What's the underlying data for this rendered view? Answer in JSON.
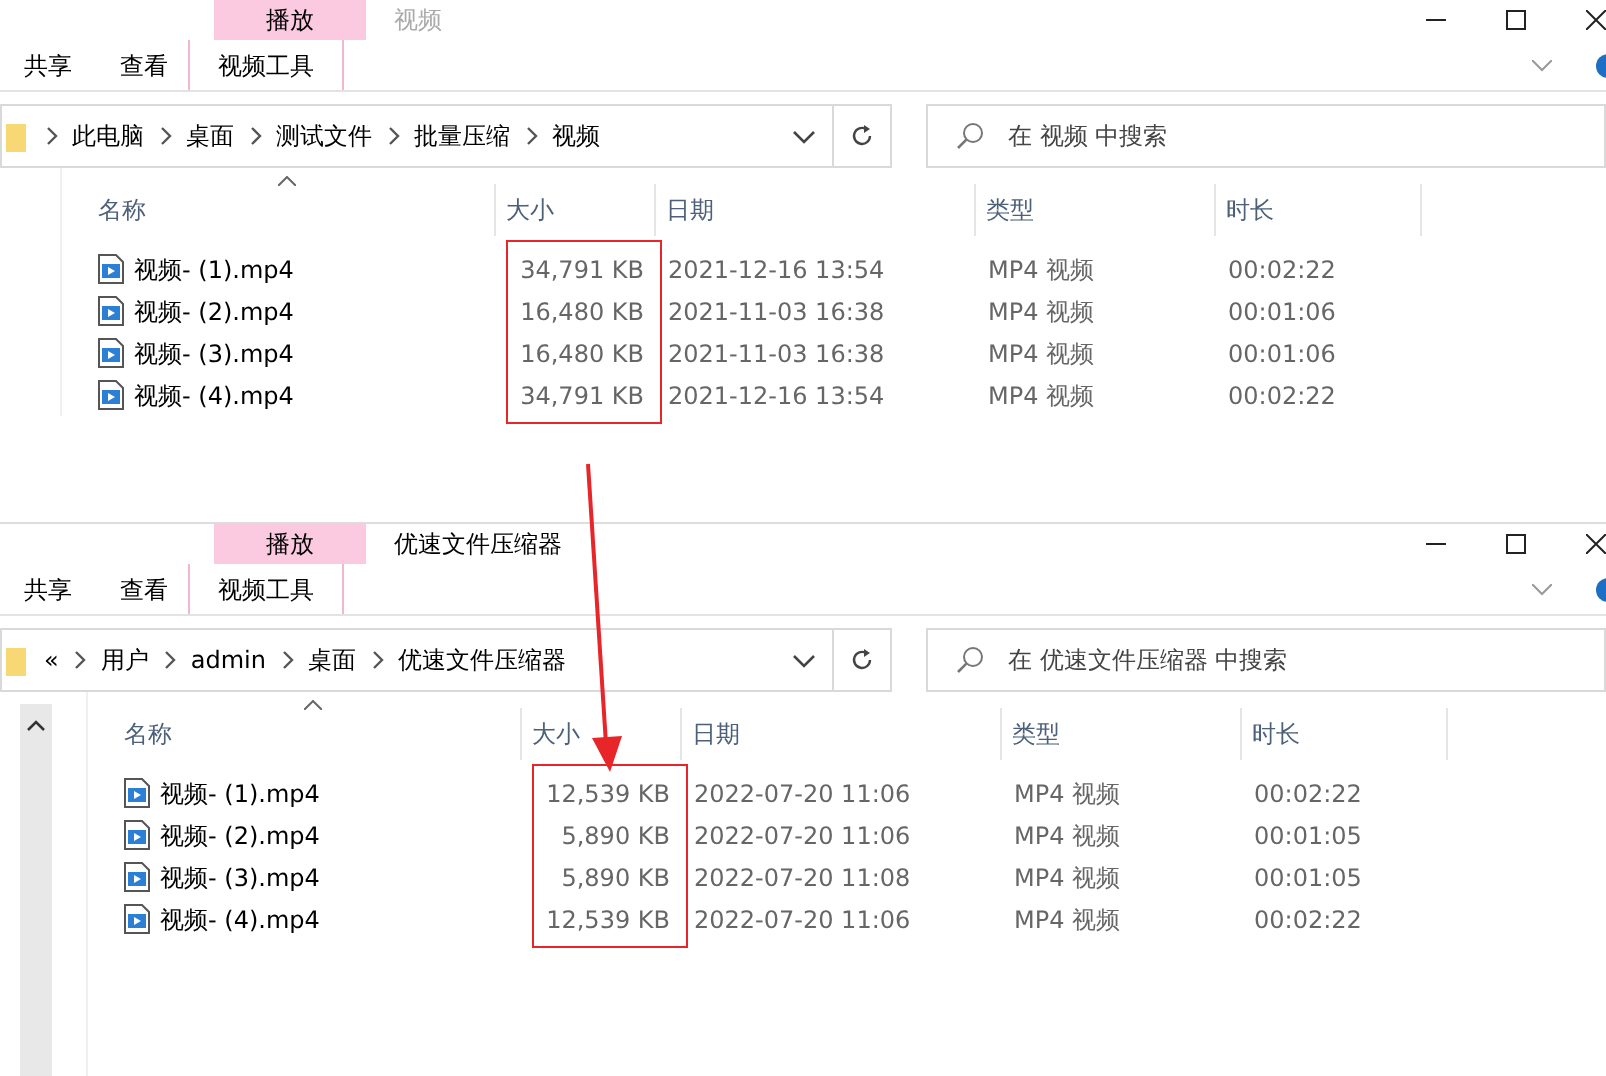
{
  "windows": [
    {
      "title": "视频",
      "active": false,
      "context_tab": "播放",
      "ribbon_tabs": [
        {
          "label": "共享",
          "selected": false
        },
        {
          "label": "查看",
          "selected": false
        },
        {
          "label": "视频工具",
          "selected": true
        }
      ],
      "scrollbar": false,
      "address": {
        "path": [
          "此电脑",
          "桌面",
          "测试文件",
          "批量压缩",
          "视频"
        ]
      },
      "search": {
        "placeholder": "在 视频 中搜索"
      },
      "columns": [
        "名称",
        "大小",
        "日期",
        "类型",
        "时长"
      ],
      "size_highlighted": true,
      "rows": [
        {
          "name": "视频- (1).mp4",
          "size": "34,791 KB",
          "date": "2021-12-16 13:54",
          "type": "MP4 视频",
          "duration": "00:02:22"
        },
        {
          "name": "视频- (2).mp4",
          "size": "16,480 KB",
          "date": "2021-11-03 16:38",
          "type": "MP4 视频",
          "duration": "00:01:06"
        },
        {
          "name": "视频- (3).mp4",
          "size": "16,480 KB",
          "date": "2021-11-03 16:38",
          "type": "MP4 视频",
          "duration": "00:01:06"
        },
        {
          "name": "视频- (4).mp4",
          "size": "34,791 KB",
          "date": "2021-12-16 13:54",
          "type": "MP4 视频",
          "duration": "00:02:22"
        }
      ]
    },
    {
      "title": "优速文件压缩器",
      "active": true,
      "context_tab": "播放",
      "ribbon_tabs": [
        {
          "label": "共享",
          "selected": false
        },
        {
          "label": "查看",
          "selected": false
        },
        {
          "label": "视频工具",
          "selected": true
        }
      ],
      "scrollbar": true,
      "address": {
        "overflow": "«",
        "path": [
          "用户",
          "admin",
          "桌面",
          "优速文件压缩器"
        ]
      },
      "search": {
        "placeholder": "在 优速文件压缩器 中搜索"
      },
      "columns": [
        "名称",
        "大小",
        "日期",
        "类型",
        "时长"
      ],
      "size_highlighted": true,
      "rows": [
        {
          "name": "视频- (1).mp4",
          "size": "12,539 KB",
          "date": "2022-07-20 11:06",
          "type": "MP4 视频",
          "duration": "00:02:22"
        },
        {
          "name": "视频- (2).mp4",
          "size": "5,890 KB",
          "date": "2022-07-20 11:06",
          "type": "MP4 视频",
          "duration": "00:01:05"
        },
        {
          "name": "视频- (3).mp4",
          "size": "5,890 KB",
          "date": "2022-07-20 11:08",
          "type": "MP4 视频",
          "duration": "00:01:05"
        },
        {
          "name": "视频- (4).mp4",
          "size": "12,539 KB",
          "date": "2022-07-20 11:06",
          "type": "MP4 视频",
          "duration": "00:02:22"
        }
      ]
    }
  ]
}
